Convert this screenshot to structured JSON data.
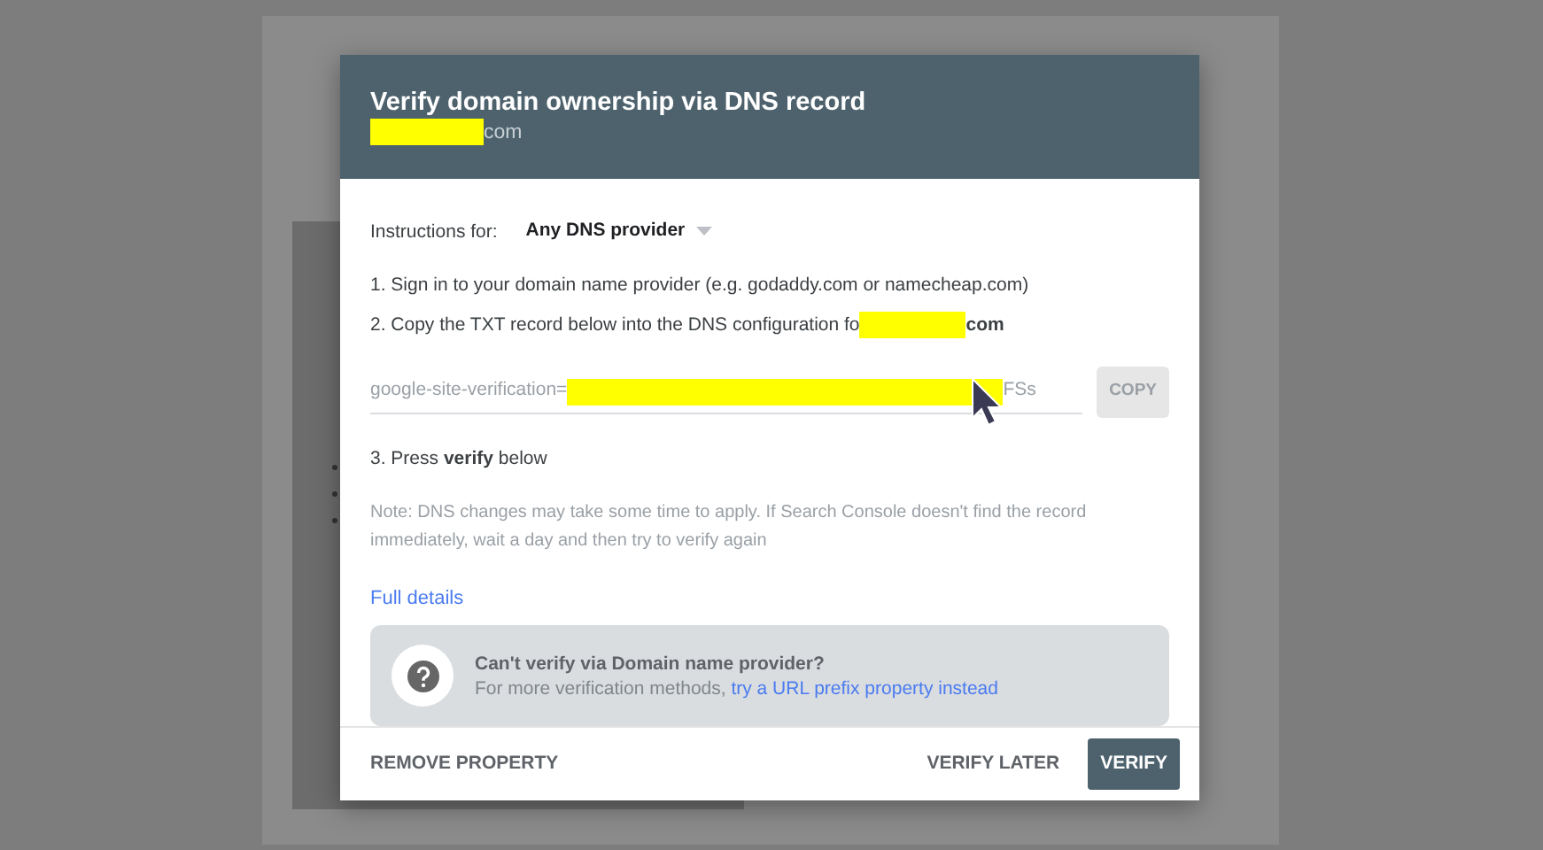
{
  "dialog": {
    "title": "Verify domain ownership via DNS record",
    "subtitle": [
      {
        "kind": "redaction"
      },
      {
        "kind": "text",
        "text": "com"
      }
    ],
    "instructions_label": "Instructions for:",
    "provider_select": {
      "value": "Any DNS provider"
    },
    "steps": [
      {
        "parts": [
          {
            "kind": "text",
            "text": "1. Sign in to your domain name provider (e.g. godaddy.com or namecheap.com)"
          }
        ]
      },
      {
        "parts": [
          {
            "kind": "text",
            "text": "2. Copy the TXT record below into the DNS configuration fo"
          },
          {
            "kind": "redaction"
          },
          {
            "kind": "bold",
            "text": "com"
          }
        ]
      }
    ],
    "record_field": {
      "parts": [
        {
          "kind": "text",
          "text": "google-site-verification="
        },
        {
          "kind": "redaction"
        },
        {
          "kind": "text",
          "text": "FSs"
        }
      ]
    },
    "copy_button": {
      "label": "COPY",
      "disabled": true
    },
    "step_3": "3. Press **verify** below",
    "note": "Note: DNS changes may take some time to apply. If Search Console doesn't find the record immediately, wait a day and then try to verify again",
    "details_link": "Full details",
    "help_box": {
      "title": "Can't verify via Domain name provider?",
      "text": "For more verification methods,",
      "link": "try a URL prefix property instead"
    },
    "buttons": [
      {
        "label": "REMOVE PROPERTY",
        "kind": "text"
      },
      {
        "label": "VERIFY LATER",
        "kind": "text"
      },
      {
        "label": "VERIFY",
        "kind": "primary"
      }
    ]
  }
}
